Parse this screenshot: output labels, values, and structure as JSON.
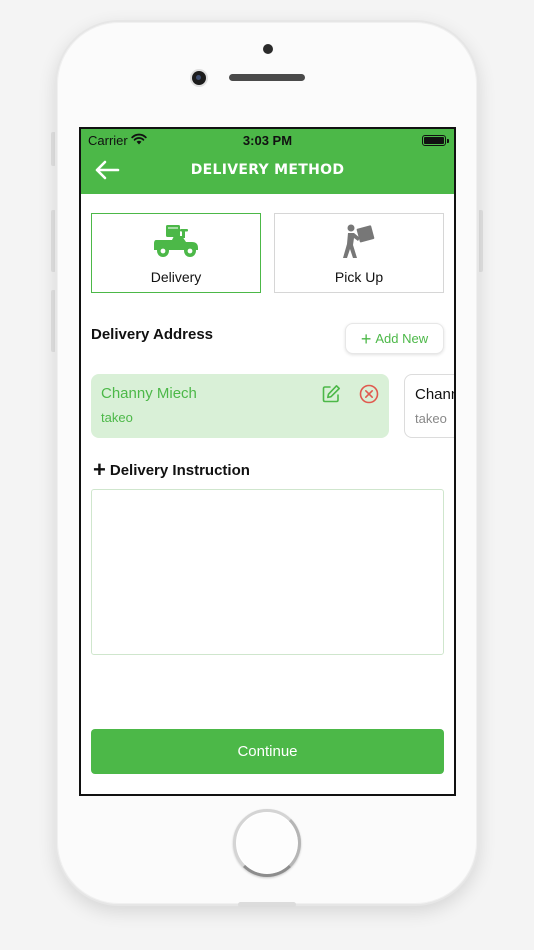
{
  "status_bar": {
    "carrier": "Carrier",
    "time": "3:03 PM"
  },
  "header": {
    "title": "DELIVERY METHOD",
    "back_icon": "arrow-left-icon"
  },
  "methods": [
    {
      "label": "Delivery",
      "icon": "scooter-icon",
      "selected": true
    },
    {
      "label": "Pick Up",
      "icon": "person-carrying-box-icon",
      "selected": false
    }
  ],
  "address_section": {
    "label": "Delivery Address",
    "add_new_label": "Add New"
  },
  "addresses": [
    {
      "name": "Channy Miech",
      "location": "takeo",
      "selected": true
    },
    {
      "name": "Channy Miech",
      "location": "takeo",
      "selected": false
    }
  ],
  "instruction": {
    "label": "Delivery Instruction",
    "value": ""
  },
  "continue_label": "Continue",
  "colors": {
    "brand_green": "#4cb848",
    "selected_card_bg": "#d9f0d7",
    "remove_red": "#e05a4f"
  }
}
